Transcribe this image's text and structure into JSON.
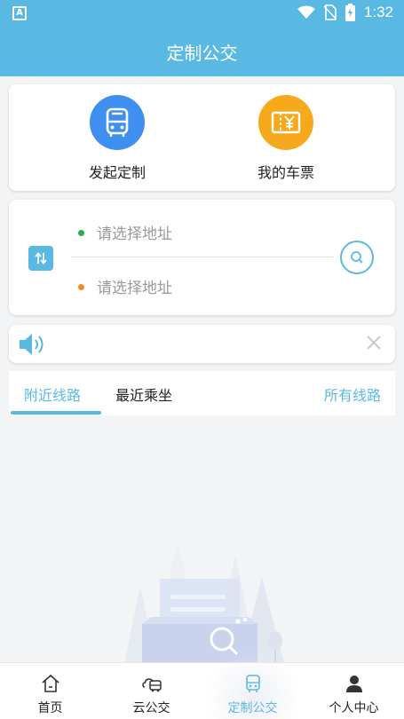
{
  "statusbar": {
    "time": "1:32",
    "app_badge": "A"
  },
  "header": {
    "title": "定制公交"
  },
  "actions": [
    {
      "label": "发起定制",
      "icon": "bus-icon",
      "color": "#3f8ff0"
    },
    {
      "label": "我的车票",
      "icon": "ticket-icon",
      "color": "#f7a91c"
    }
  ],
  "route": {
    "from_placeholder": "请选择地址",
    "to_placeholder": "请选择地址",
    "from_dot_color": "#22b14c",
    "to_dot_color": "#f08c1e"
  },
  "tabs": {
    "nearby": "附近线路",
    "recent": "最近乘坐",
    "all": "所有线路"
  },
  "bottom_nav": [
    {
      "label": "首页",
      "icon": "home-icon"
    },
    {
      "label": "云公交",
      "icon": "cloud-bus-icon"
    },
    {
      "label": "定制公交",
      "icon": "custom-bus-icon",
      "active": true
    },
    {
      "label": "个人中心",
      "icon": "person-icon"
    }
  ],
  "colors": {
    "accent": "#5ab9e2"
  }
}
